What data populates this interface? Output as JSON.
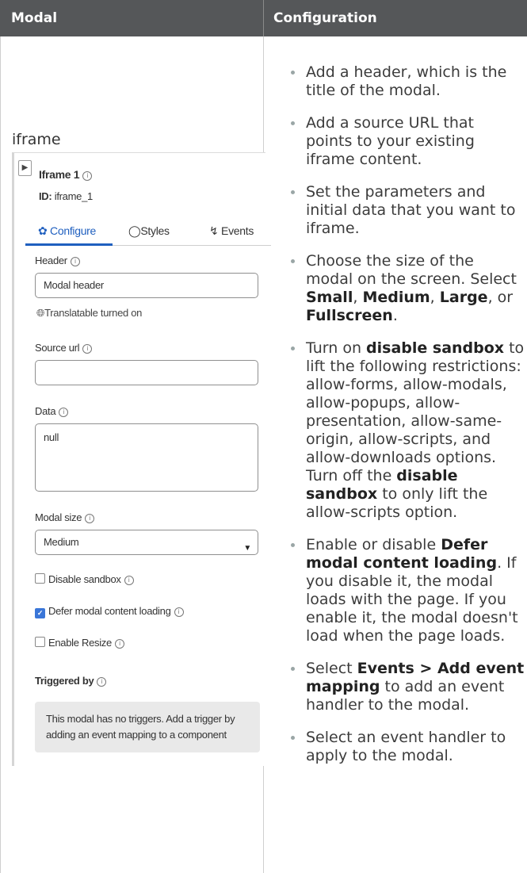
{
  "table": {
    "col_modal": "Modal",
    "col_configuration": "Configuration"
  },
  "left": {
    "caption": "iframe",
    "panel": {
      "icon": "expand-panel-icon",
      "title": "Iframe 1",
      "id_label": "ID:",
      "id_value": "iframe_1",
      "tabs": [
        {
          "icon": "gear-icon",
          "label": "Configure",
          "active": true
        },
        {
          "icon": "palette-icon",
          "label": "Styles",
          "active": false
        },
        {
          "icon": "lightning-icon",
          "label": "Events",
          "active": false
        }
      ],
      "header_label": "Header",
      "header_value": "Modal header",
      "translatable_text": "Translatable turned on",
      "source_url_label": "Source url",
      "source_url_value": "",
      "data_label": "Data",
      "data_value": "null",
      "modal_size_label": "Modal size",
      "modal_size_value": "Medium",
      "checkboxes": [
        {
          "label": "Disable sandbox",
          "checked": false
        },
        {
          "label": "Defer modal content loading",
          "checked": true
        },
        {
          "label": "Enable Resize",
          "checked": false
        }
      ],
      "triggered_by_label": "Triggered by",
      "no_triggers_text": "This modal has no triggers. Add a trigger by adding an event mapping to a component"
    }
  },
  "right": {
    "items": [
      [
        "Add a header, which is the title of the modal."
      ],
      [
        "Add a source URL that points to your existing iframe content."
      ],
      [
        "Set the parameters and initial data that you want to iframe."
      ],
      [
        "Choose the size of the modal on the screen. Select ",
        {
          "b": "Small"
        },
        ", ",
        {
          "b": "Medium"
        },
        ", ",
        {
          "b": "Large"
        },
        ", or ",
        {
          "b": "Fullscreen"
        },
        "."
      ],
      [
        "Turn on ",
        {
          "b": "disable sandbox"
        },
        " to lift the following restrictions: allow-forms, allow-modals, allow-popups, allow-presentation, allow-same-origin, allow-scripts, and allow-downloads options. Turn off the ",
        {
          "b": "disable sandbox"
        },
        " to only lift the allow-scripts option."
      ],
      [
        "Enable or disable ",
        {
          "b": "Defer modal content loading"
        },
        ". If you disable it, the modal loads with the page. If you enable it, the modal doesn't load when the page loads."
      ],
      [
        "Select ",
        {
          "b": "Events > Add event mapping"
        },
        " to add an event handler to the modal."
      ],
      [
        "Select an event handler to apply to the modal."
      ]
    ]
  }
}
